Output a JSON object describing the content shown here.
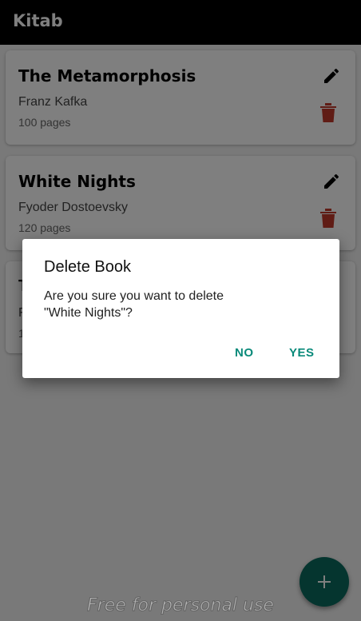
{
  "app": {
    "title": "Kitab"
  },
  "books": [
    {
      "title": "The Metamorphosis",
      "author": "Franz Kafka",
      "pages": "100 pages"
    },
    {
      "title": "White Nights",
      "author": "Fyoder Dostoevsky",
      "pages": "120 pages"
    }
  ],
  "partial_card": {
    "title_fragment": "T",
    "author_fragment": "F",
    "pages_fragment": "1"
  },
  "dialog": {
    "title": "Delete Book",
    "message": "Are you sure you want to delete\n\"White Nights\"?",
    "no_label": "NO",
    "yes_label": "YES"
  },
  "fab": {
    "icon": "plus-icon"
  },
  "watermark": "Free for personal use",
  "colors": {
    "app_bar": "#000000",
    "accent": "#0a8a7a",
    "fab": "#0a6b5e",
    "delete_icon": "#c0392b"
  }
}
